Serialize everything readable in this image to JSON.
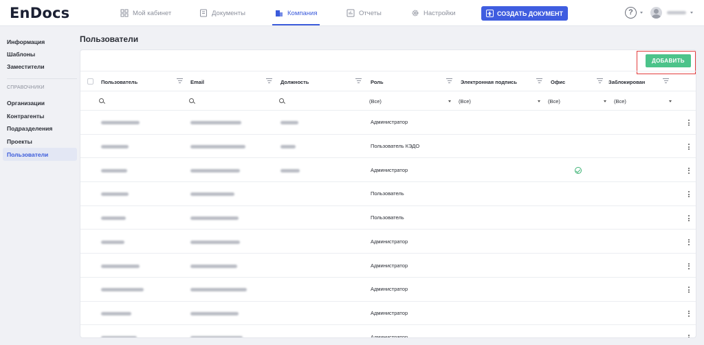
{
  "app": {
    "logo": "EnDocs"
  },
  "nav": {
    "items": [
      {
        "label": "Мой кабинет",
        "icon": "dashboard-icon",
        "active": false
      },
      {
        "label": "Документы",
        "icon": "document-icon",
        "active": false
      },
      {
        "label": "Компания",
        "icon": "building-icon",
        "active": true
      },
      {
        "label": "Отчеты",
        "icon": "chart-icon",
        "active": false
      },
      {
        "label": "Настройки",
        "icon": "gear-icon",
        "active": false
      }
    ],
    "create_label": "СОЗДАТЬ ДОКУМЕНТ",
    "help_symbol": "?"
  },
  "sidebar": {
    "items": [
      {
        "label": "Информация"
      },
      {
        "label": "Шаблоны"
      },
      {
        "label": "Заместители"
      }
    ],
    "section_caption": "СПРАВОЧНИКИ",
    "ref_items": [
      {
        "label": "Организации"
      },
      {
        "label": "Контрагенты"
      },
      {
        "label": "Подразделения"
      },
      {
        "label": "Проекты"
      },
      {
        "label": "Пользователи",
        "active": true
      }
    ]
  },
  "page": {
    "title": "Пользователи",
    "add_label": "ДОБАВИТЬ"
  },
  "table": {
    "columns": [
      {
        "label": "Пользователь"
      },
      {
        "label": "Email"
      },
      {
        "label": "Должность"
      },
      {
        "label": "Роль"
      },
      {
        "label": "Электронная подпись"
      },
      {
        "label": "Офис"
      },
      {
        "label": "Заблокирован"
      }
    ],
    "filters": {
      "role": "(Все)",
      "signature": "(Все)",
      "office": "(Все)",
      "blocked": "(Все)"
    },
    "rows": [
      {
        "role": "Администратор",
        "office_check": false
      },
      {
        "role": "Пользователь КЭДО",
        "office_check": false
      },
      {
        "role": "Администратор",
        "office_check": true
      },
      {
        "role": "Пользователь",
        "office_check": false
      },
      {
        "role": "Пользователь",
        "office_check": false
      },
      {
        "role": "Администратор",
        "office_check": false
      },
      {
        "role": "Администратор",
        "office_check": false
      },
      {
        "role": "Администратор",
        "office_check": false
      },
      {
        "role": "Администратор",
        "office_check": false
      },
      {
        "role": "Администратор",
        "office_check": false
      }
    ]
  },
  "colors": {
    "accent": "#3f5de0",
    "add": "#4cc38a",
    "highlight": "#e23b3b",
    "ok": "#3bb273"
  }
}
